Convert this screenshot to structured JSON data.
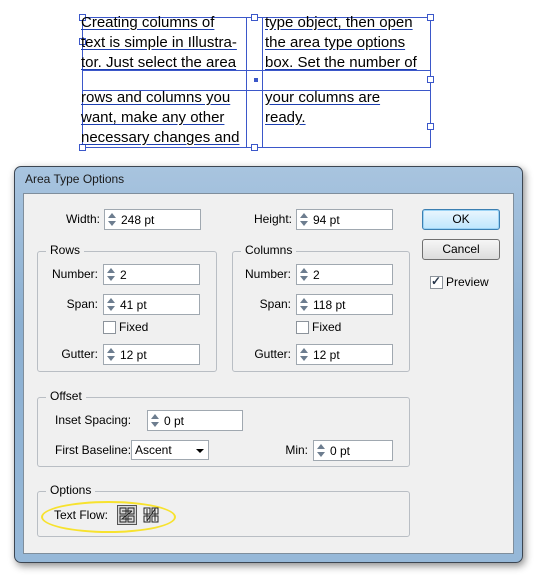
{
  "artwork": {
    "col1_lines": [
      "Creating columns of",
      "text is simple in Illustra-",
      "tor. Just select the area",
      "rows and columns you",
      "want, make any other",
      "necessary changes and"
    ],
    "col2_lines": [
      "type object, then open",
      "the area type options",
      "box. Set the number of",
      "your columns are",
      "ready."
    ]
  },
  "dialog": {
    "title": "Area Type Options",
    "width_label": "Width:",
    "width_value": "248 pt",
    "height_label": "Height:",
    "height_value": "94 pt",
    "ok_label": "OK",
    "cancel_label": "Cancel",
    "preview_label": "Preview",
    "preview_checked": true,
    "rows": {
      "title": "Rows",
      "number_label": "Number:",
      "number_value": "2",
      "span_label": "Span:",
      "span_value": "41 pt",
      "fixed_label": "Fixed",
      "gutter_label": "Gutter:",
      "gutter_value": "12 pt"
    },
    "columns": {
      "title": "Columns",
      "number_label": "Number:",
      "number_value": "2",
      "span_label": "Span:",
      "span_value": "118 pt",
      "fixed_label": "Fixed",
      "gutter_label": "Gutter:",
      "gutter_value": "12 pt"
    },
    "offset": {
      "title": "Offset",
      "inset_label": "Inset Spacing:",
      "inset_value": "0 pt",
      "first_baseline_label": "First Baseline:",
      "first_baseline_value": "Ascent",
      "min_label": "Min:",
      "min_value": "0 pt"
    },
    "options": {
      "title": "Options",
      "text_flow_label": "Text Flow:"
    }
  },
  "colors": {
    "selection_blue": "#3b57c9",
    "highlight_yellow": "#f7e22e",
    "titlebar": "#96b8d8"
  },
  "icons": {
    "text_flow_rows": "text-flow-by-rows-icon",
    "text_flow_columns": "text-flow-by-columns-icon"
  }
}
